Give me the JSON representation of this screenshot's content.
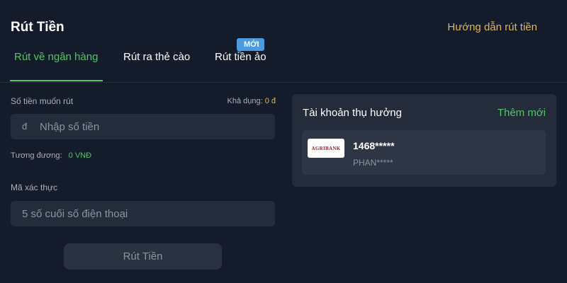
{
  "header": {
    "title": "Rút Tiền",
    "guide_link": "Hướng dẫn rút tiền"
  },
  "tabs": [
    {
      "label": "Rút về ngân hàng",
      "active": true
    },
    {
      "label": "Rút ra thẻ cào",
      "active": false
    },
    {
      "label": "Rút tiền ảo",
      "active": false,
      "badge": "MỚI"
    }
  ],
  "form": {
    "amount_label": "Số tiền muốn rút",
    "available_label": "Khả dụng:",
    "available_value": "0 đ",
    "currency_symbol": "đ",
    "amount_placeholder": "Nhập số tiền",
    "amount_value": "",
    "equivalent_label": "Tương đương:",
    "equivalent_value": "0 VNĐ",
    "otp_label": "Mã xác thực",
    "otp_placeholder": "5 số cuối số điện thoại",
    "otp_value": "",
    "submit_label": "Rút Tiền"
  },
  "beneficiary": {
    "title": "Tài khoản thụ hưởng",
    "add_new": "Thêm mới",
    "accounts": [
      {
        "bank_logo_text": "AGRIBANK",
        "number": "1468*****",
        "name": "PHAN*****"
      }
    ]
  },
  "colors": {
    "background": "#141b2b",
    "accent_green": "#52c46a",
    "accent_gold": "#e0b55a",
    "badge_blue": "#4a9be0"
  }
}
